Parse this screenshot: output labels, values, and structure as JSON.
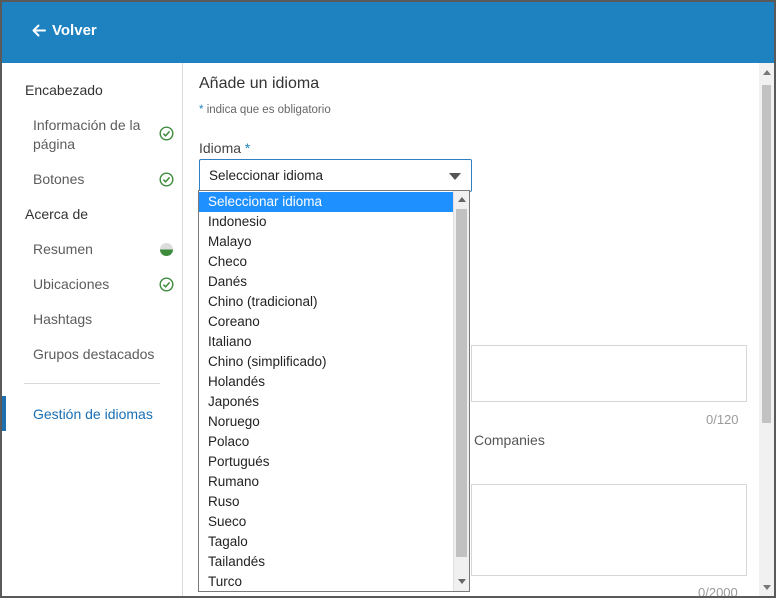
{
  "header": {
    "back_label": "Volver",
    "color": "#1e82c1"
  },
  "sidebar": {
    "section1": "Encabezado",
    "item_info_line1": "Información de la",
    "item_info_line2": "página",
    "item_buttons": "Botones",
    "section2": "Acerca de",
    "item_summary": "Resumen",
    "item_locations": "Ubicaciones",
    "item_hashtags": "Hashtags",
    "item_groups": "Grupos destacados",
    "active_item": "Gestión de idiomas",
    "status_icons": {
      "info": "check-circle-icon",
      "buttons": "check-circle-icon",
      "summary": "half-filled-circle-icon",
      "locations": "check-circle-icon"
    }
  },
  "form": {
    "title": "Añade un idioma",
    "required_star": "*",
    "required_note": "indica que es obligatorio",
    "language_label": "Idioma",
    "language_selected": "Seleccionar idioma",
    "textarea1_count": "0/120",
    "companies_text": "Companies",
    "textarea2_count": "0/2000"
  },
  "dropdown": {
    "options": [
      "Seleccionar idioma",
      "Indonesio",
      "Malayo",
      "Checo",
      "Danés",
      "Chino (tradicional)",
      "Coreano",
      "Italiano",
      "Chino (simplificado)",
      "Holandés",
      "Japonés",
      "Noruego",
      "Polaco",
      "Portugués",
      "Rumano",
      "Ruso",
      "Sueco",
      "Tagalo",
      "Tailandés",
      "Turco"
    ],
    "selected_index": 0
  },
  "colors": {
    "accent": "#1e82c1",
    "check": "#3c8c3c",
    "highlight": "#1e90ff"
  }
}
